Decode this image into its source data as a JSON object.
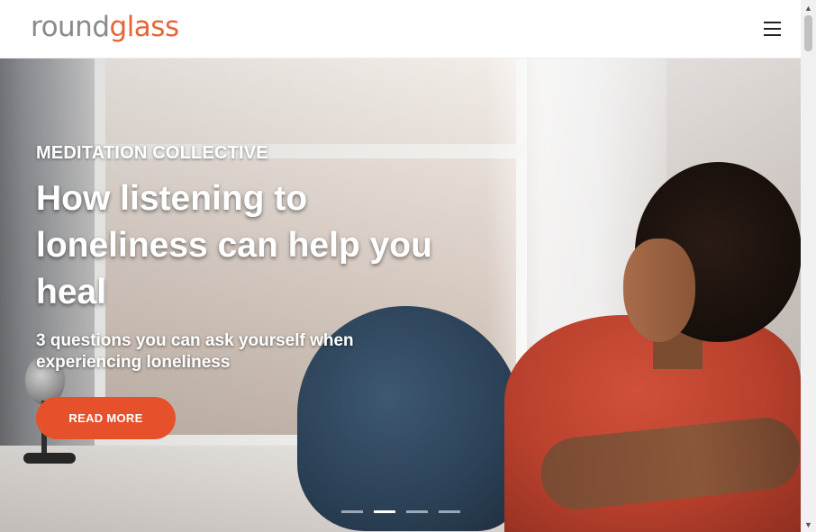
{
  "header": {
    "logo_part_a": "round",
    "logo_part_b": "glass",
    "menu_icon": "hamburger-menu-icon"
  },
  "hero": {
    "kicker": "MEDITATION COLLECTIVE",
    "headline": "How listening to loneliness can help you heal",
    "subhead": "3 questions you can ask yourself when experiencing loneliness",
    "cta_label": "READ MORE",
    "carousel": {
      "slide_count": 4,
      "active_index": 1
    }
  },
  "colors": {
    "brand_accent": "#e6512b",
    "logo_gray": "#8a8a8a",
    "logo_orange": "#e6643a"
  },
  "scrollbar": {
    "up_icon": "scroll-up-arrow-icon",
    "down_icon": "scroll-down-arrow-icon"
  }
}
